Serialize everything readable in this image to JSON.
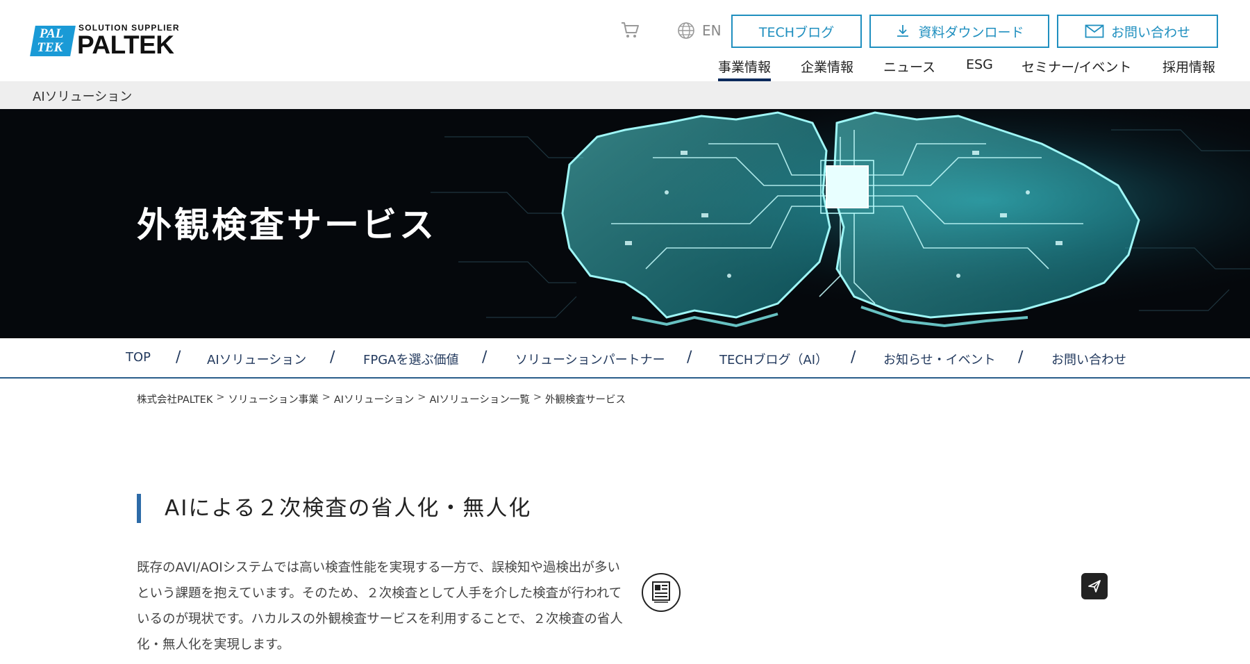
{
  "brand": {
    "tagline": "SOLUTION SUPPLIER",
    "name": "PALTEK",
    "mark_line1": "PAL",
    "mark_line2": "TEK"
  },
  "header": {
    "cart_icon": "cart-icon",
    "lang_label": "EN",
    "tech_button": "TECHブログ",
    "download_button": "資料ダウンロード",
    "contact_button": "お問い合わせ",
    "accent_color": "#1f8fbf"
  },
  "main_nav": [
    {
      "label": "事業情報",
      "active": true
    },
    {
      "label": "企業情報"
    },
    {
      "label": "ニュース"
    },
    {
      "label": "ESG"
    },
    {
      "label": "セミナー/イベント"
    },
    {
      "label": "採用情報"
    }
  ],
  "section_label": "AIソリューション",
  "hero": {
    "title": "外観検査サービス"
  },
  "sub_nav": [
    "TOP",
    "AIソリューション",
    "FPGAを選ぶ価値",
    "ソリューションパートナー",
    "TECHブログ（AI）",
    "お知らせ・イベント",
    "お問い合わせ"
  ],
  "sub_nav_separator": "/",
  "breadcrumb": [
    "株式会社PALTEK",
    "ソリューション事業",
    "AIソリューション",
    "AIソリューション一覧",
    "外観検査サービス"
  ],
  "breadcrumb_separator": ">",
  "content": {
    "heading": "AIによる２次検査の省人化・無人化",
    "paragraph": "既存のAVI/AOIシステムでは高い検査性能を実現する一方で、誤検知や過検出が多いという課題を抱えています。そのため、２次検査として人手を介した検査が行われているのが現状です。ハカルスの外観検査サービスを利用することで、２次検査の省人化・無人化を実現します。"
  },
  "floating": {
    "book_icon": "book-reader-icon",
    "send_icon": "send-icon"
  }
}
